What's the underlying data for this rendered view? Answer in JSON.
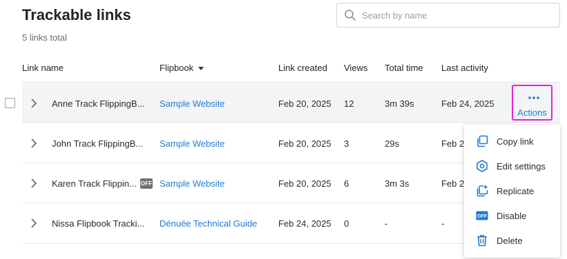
{
  "page": {
    "title": "Trackable links",
    "subtitle": "5 links total"
  },
  "search": {
    "placeholder": "Search by name"
  },
  "columns": {
    "link_name": "Link name",
    "flipbook": "Flipbook",
    "link_created": "Link created",
    "views": "Views",
    "total_time": "Total time",
    "last_activity": "Last activity"
  },
  "rows": [
    {
      "name": "Anne Track FlippingB...",
      "flipbook": "Sample Website",
      "created": "Feb 20, 2025",
      "views": "12",
      "total_time": "3m 39s",
      "last_activity": "Feb 24, 2025"
    },
    {
      "name": "John Track FlippingB...",
      "flipbook": "Sample Website",
      "created": "Feb 20, 2025",
      "views": "3",
      "total_time": "29s",
      "last_activity": "Feb 24"
    },
    {
      "name": "Karen Track Flippin...",
      "badge": "OFF",
      "flipbook": "Sample Website",
      "created": "Feb 20, 2025",
      "views": "6",
      "total_time": "3m 3s",
      "last_activity": "Feb 24"
    },
    {
      "name": "Nissa Flipbook Tracki...",
      "flipbook": "Dénuée Technical Guide",
      "created": "Feb 24, 2025",
      "views": "0",
      "total_time": "-",
      "last_activity": "-"
    }
  ],
  "actions": {
    "label": "Actions"
  },
  "menu": {
    "items": [
      {
        "label": "Copy link",
        "icon": "copy-icon"
      },
      {
        "label": "Edit settings",
        "icon": "settings-hexagon-icon"
      },
      {
        "label": "Replicate",
        "icon": "replicate-icon"
      },
      {
        "label": "Disable",
        "icon": "off-badge-icon",
        "icon_text": "OFF"
      },
      {
        "label": "Delete",
        "icon": "trash-icon"
      }
    ]
  },
  "colors": {
    "accent": "#1f7ad6",
    "highlight_border": "#e61fd5",
    "row_highlight": "#f3f4f6"
  }
}
